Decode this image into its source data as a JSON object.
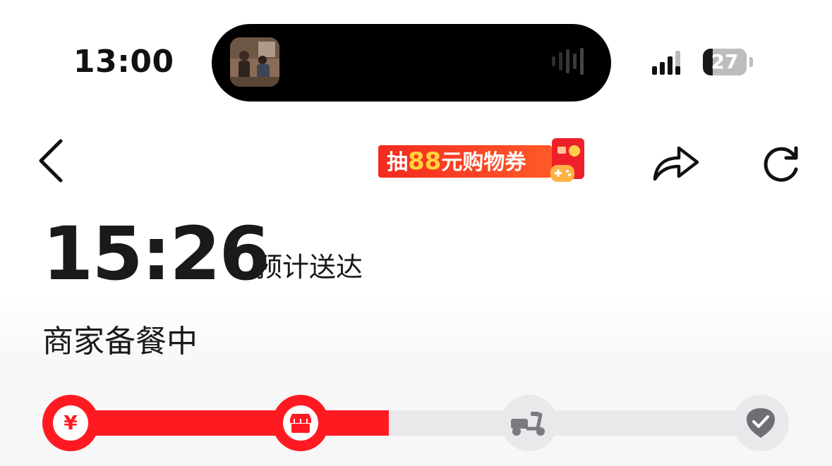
{
  "status_bar": {
    "time": "13:00",
    "battery": "27",
    "battery_level_percent": 27,
    "island_thumb_icon": "now-playing-thumbnail",
    "signal_icon": "cellular-signal-icon"
  },
  "nav": {
    "back_icon": "chevron-left-icon",
    "promo": {
      "prefix": "抽",
      "amount": "88",
      "suffix": "元购物券"
    },
    "promo_icon": "gift-game-icon",
    "share_icon": "share-icon",
    "refresh_icon": "refresh-icon"
  },
  "eta": {
    "time": "15:26",
    "label": "预计送达"
  },
  "order_status": "商家备餐中",
  "progress": {
    "fill_fraction": 0.46,
    "steps": [
      {
        "icon": "yen-icon",
        "symbol": "¥",
        "state": "done"
      },
      {
        "icon": "store-icon",
        "state": "done"
      },
      {
        "icon": "scooter-icon",
        "state": "pending"
      },
      {
        "icon": "check-badge-icon",
        "state": "pending"
      }
    ]
  },
  "colors": {
    "accent": "#ff1a22",
    "inactive": "#e9e9ec",
    "promo_amount": "#ffd33a"
  }
}
